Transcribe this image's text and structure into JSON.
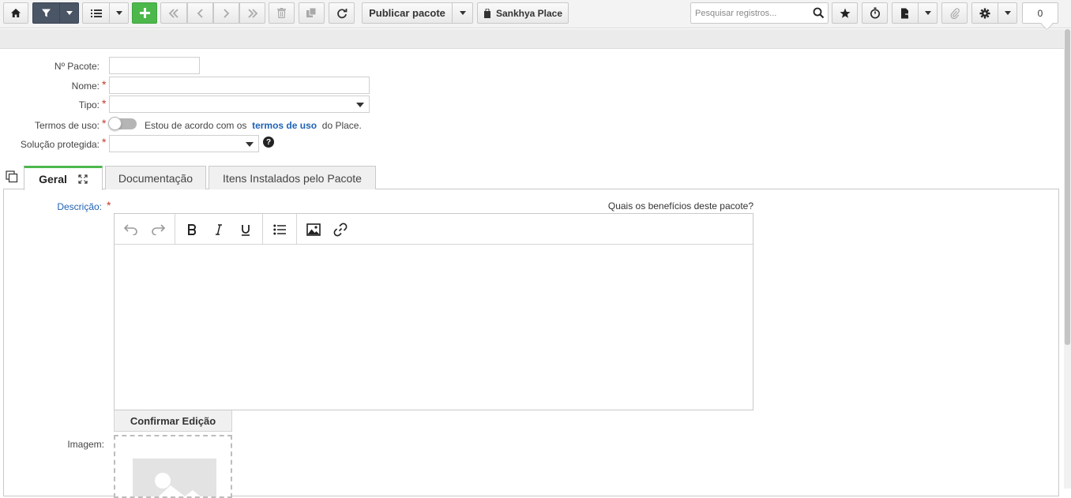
{
  "toolbar": {
    "publish_label": "Publicar pacote",
    "place_label": "Sankhya Place",
    "search_placeholder": "Pesquisar registros...",
    "count": "0",
    "icons": {
      "home": "home-icon",
      "filter": "filter-icon",
      "list": "list-icon",
      "add": "plus-icon",
      "first": "double-chevron-left-icon",
      "prev": "chevron-left-icon",
      "next": "chevron-right-icon",
      "last": "double-chevron-right-icon",
      "delete": "trash-icon",
      "duplicate": "copy-icon",
      "refresh": "refresh-icon",
      "search": "search-icon",
      "favorite": "star-icon",
      "timer": "stopwatch-icon",
      "export": "export-icon",
      "attach": "paperclip-icon",
      "settings": "gear-icon"
    }
  },
  "form": {
    "pacote_label": "Nº Pacote:",
    "pacote_value": "",
    "nome_label": "Nome:",
    "nome_value": "",
    "tipo_label": "Tipo:",
    "tipo_value": "",
    "termos_label": "Termos de uso:",
    "termos_prefix": "Estou de acordo com os",
    "termos_link": "termos de uso",
    "termos_suffix": "do Place.",
    "termos_checked": false,
    "solucao_label": "Solução protegida:",
    "solucao_value": "",
    "required_mark": "*",
    "help_mark": "?"
  },
  "tabs": [
    {
      "label": "Geral",
      "active": true
    },
    {
      "label": "Documentação",
      "active": false
    },
    {
      "label": "Itens Instalados pelo Pacote",
      "active": false
    }
  ],
  "geral": {
    "descricao_label": "Descrição:",
    "descricao_hint": "Quais os benefícios deste pacote?",
    "descricao_value": "",
    "confirm_label": "Confirmar Edição",
    "imagem_label": "Imagem:"
  },
  "colors": {
    "accent_green": "#4cb84c",
    "dark_button": "#4a5566",
    "link_blue": "#1f63b5",
    "required_red": "#c0392b"
  }
}
